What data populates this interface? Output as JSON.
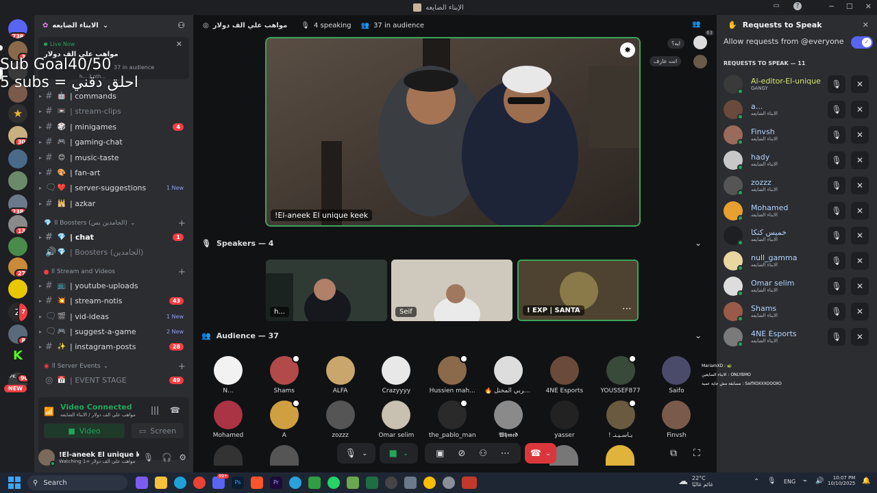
{
  "window": {
    "title": "الإبناء الضايعه"
  },
  "guilds": [
    {
      "badge": "738"
    },
    {
      "badge": "3"
    },
    {
      "badge": ""
    },
    {
      "badge": ""
    },
    {
      "badge": ""
    },
    {
      "badge": "30"
    },
    {
      "badge": ""
    },
    {
      "badge": "238"
    },
    {
      "badge": "13"
    },
    {
      "badge": ""
    },
    {
      "badge": "27"
    },
    {
      "badge": ""
    },
    {
      "badge": "7"
    },
    {
      "badge": "8"
    },
    {
      "badge": ""
    },
    {
      "badge": "90"
    }
  ],
  "guild_new_label": "NEW",
  "guild_pk_label": "PK",
  "server": {
    "name": "الابناء الضايعه"
  },
  "live_card": {
    "status": "Live Now",
    "title": "مواهب علي الف دولار",
    "audience": "37 in audience",
    "sub": "h... 3 oth..."
  },
  "overlay": {
    "line1": "Sub Goal40/50",
    "line2": "5 subs = احلق دقني"
  },
  "channels": [
    {
      "name": "commands",
      "emoji": "🤖",
      "type": "text",
      "count": "",
      "new": ""
    },
    {
      "name": "stream-clips",
      "emoji": "📼",
      "type": "text",
      "count": "",
      "new": "",
      "muted": true
    },
    {
      "name": "minigames",
      "emoji": "🎲",
      "type": "text",
      "count": "4",
      "new": ""
    },
    {
      "name": "gaming-chat",
      "emoji": "🎮",
      "type": "text",
      "count": "",
      "new": ""
    },
    {
      "name": "music-taste",
      "emoji": "😊",
      "type": "text",
      "count": "",
      "new": ""
    },
    {
      "name": "fan-art",
      "emoji": "🎨",
      "type": "text",
      "count": "",
      "new": ""
    },
    {
      "name": "server-suggestions",
      "emoji": "❤️",
      "type": "forum",
      "count": "",
      "new": "1 New"
    },
    {
      "name": "azkar",
      "emoji": "🕌",
      "type": "text",
      "count": "",
      "new": ""
    }
  ],
  "cat_boosters": "ll Boosters (الجامدين بس)",
  "boost_channels": [
    {
      "name": "chat",
      "emoji": "💎",
      "type": "text",
      "count": "1"
    },
    {
      "name": "Boosters (الجامدين)",
      "emoji": "💎",
      "type": "voice",
      "count": ""
    }
  ],
  "cat_stream": "ll Stream and Videos",
  "stream_channels": [
    {
      "name": "youtube-uploads",
      "emoji": "📺",
      "type": "text",
      "count": "",
      "new": ""
    },
    {
      "name": "stream-notis",
      "emoji": "💥",
      "type": "text",
      "count": "43",
      "new": ""
    },
    {
      "name": "vid-ideas",
      "emoji": "🎬",
      "type": "forum",
      "count": "",
      "new": "1 New"
    },
    {
      "name": "suggest-a-game",
      "emoji": "🎮",
      "type": "forum",
      "count": "",
      "new": "2 New"
    },
    {
      "name": "instagram-posts",
      "emoji": "✨",
      "type": "text",
      "count": "28",
      "new": ""
    }
  ],
  "cat_events": "ll Server Events",
  "event_stage": {
    "name": "EVENT STAGE",
    "count": "49"
  },
  "voice": {
    "status": "Video Connected",
    "where": "مواهب علي الف دولار / الابناء الضايعه",
    "video_btn": "Video",
    "screen_btn": "Screen"
  },
  "user": {
    "name": "!El-aneek El unique keek",
    "status": "Watching مواهب علي الف دولار +1"
  },
  "stage": {
    "title": "مواهب علي الف دولار",
    "speaking": "4 speaking",
    "audience": "37 in audience",
    "viewer_count": "63"
  },
  "main_video": {
    "label": "!El-aneek El unique keek"
  },
  "chat_bubbles": [
    "ايه؟",
    "انت عارف"
  ],
  "speakers": {
    "header": "Speakers — 4",
    "tiles": [
      "h...",
      "Seif",
      "! EXP | SANTA"
    ]
  },
  "audience": {
    "header": "Audience — 37",
    "row1": [
      "N...",
      "Shams",
      "ALFA",
      "Crazyyyy",
      "Hussien mah...",
      "🔥 المغربي المختل...",
      "4NE Esports",
      "YOUSSEF877",
      "Saifo"
    ],
    "row2": [
      "Mohamed",
      "A",
      "zozzz",
      "Omar selim",
      "the_pablo_man",
      "𝖂𝖍𝖒𝖊𝖉",
      "yasser",
      "! يـاسـيـنـ",
      "Finvsh"
    ]
  },
  "requests": {
    "title": "Requests to Speak",
    "allow_label": "Allow requests from @everyone",
    "count_label": "REQUESTS TO SPEAK — 11",
    "items": [
      {
        "name": "Al-editor-El-unique",
        "sub": "GANGY",
        "color": "#d8e86b"
      },
      {
        "name": "a...",
        "sub": "الابناء الضايعه",
        "color": "#b4d6ff"
      },
      {
        "name": "Finvsh",
        "sub": "الابناء الضايعه",
        "color": "#b4d6ff"
      },
      {
        "name": "hady",
        "sub": "الابناء الضايعه",
        "color": "#b4d6ff"
      },
      {
        "name": "zozzz",
        "sub": "الابناء الضايعه",
        "color": "#b4d6ff"
      },
      {
        "name": "Mohamed",
        "sub": "الابناء الضايعه",
        "color": "#b4d6ff"
      },
      {
        "name": "خميس كتكا",
        "sub": "الابناء الضايعه",
        "color": "#b4d6ff"
      },
      {
        "name": "null_gamma",
        "sub": "الابناء الضايعه",
        "color": "#b4d6ff"
      },
      {
        "name": "Omar selim",
        "sub": "الابناء الضايعه",
        "color": "#b4d6ff"
      },
      {
        "name": "Shams",
        "sub": "الابناء الضايعه",
        "color": "#b4d6ff"
      },
      {
        "name": "4NE Esports",
        "sub": "الابناء الضايعه",
        "color": "#b4d6ff"
      }
    ]
  },
  "chat_overlay": [
    "MariamXD : 🐢",
    "الابناء الضايعين : ONLYBMO",
    "مسابقة مش جاية عمية : SaifXOXXXOOOXO"
  ],
  "taskbar": {
    "search": "Search",
    "weather_temp": "22°C",
    "weather_desc": "غائم غالبًا",
    "lang": "ENG",
    "time": "10:07 PM",
    "date": "10/10/2025",
    "discord_badge": "99+"
  }
}
